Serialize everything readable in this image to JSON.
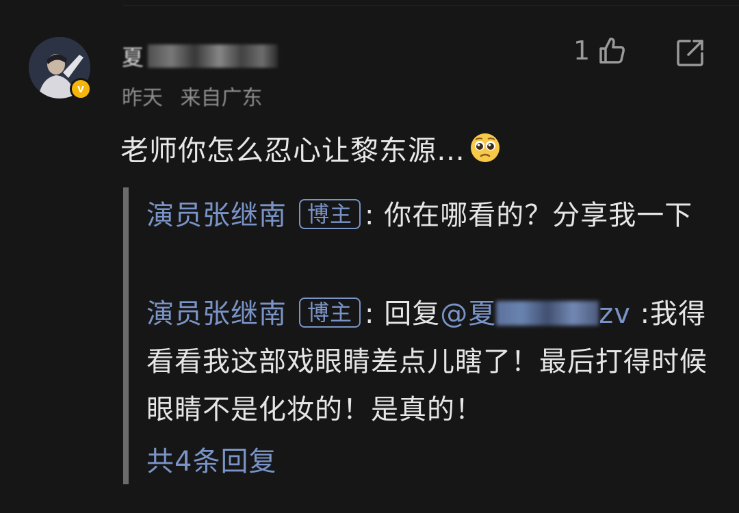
{
  "comment": {
    "username_visible": "夏",
    "meta_time": "昨天",
    "meta_location": "来自广东",
    "like_count": "1",
    "text": "老师你怎么忍心让黎东源…",
    "emoji_icon": "pleading-face-emoji",
    "verified_color": "#f5b50a"
  },
  "replies": [
    {
      "author": "演员张继南",
      "tag": "博主",
      "separator": ": ",
      "text": "你在哪看的？分享我一下"
    },
    {
      "author": "演员张继南",
      "tag": "博主",
      "separator": ": ",
      "prefix": "回复",
      "mention_start": "@夏",
      "mention_end": "zv",
      "text": " :我得看看我这部戏眼睛差点儿瞎了！最后打得时候眼睛不是化妆的！是真的！"
    }
  ],
  "more_replies": "共4条回复",
  "colors": {
    "background": "#161616",
    "link": "#7a94c8",
    "text": "#e6e6e6",
    "muted": "#8d8d8d"
  }
}
